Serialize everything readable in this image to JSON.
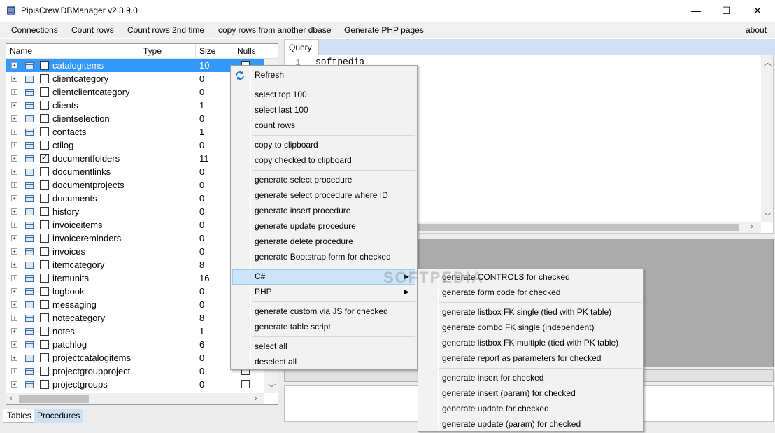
{
  "window": {
    "title": "PipisCrew.DBManager v2.3.9.0",
    "minimize_glyph": "—",
    "maximize_glyph": "☐",
    "close_glyph": "✕"
  },
  "menu": {
    "connections": "Connections",
    "count_rows": "Count rows",
    "count_rows_2nd": "Count rows 2nd time",
    "copy_rows": "copy rows from another dbase",
    "generate_php": "Generate PHP pages",
    "about": "about"
  },
  "tree": {
    "headers": {
      "name": "Name",
      "type": "Type",
      "size": "Size",
      "nulls": "Nulls"
    },
    "rows": [
      {
        "name": "catalogitems",
        "size": "10",
        "checked": false,
        "selected": true
      },
      {
        "name": "clientcategory",
        "size": "0",
        "checked": false
      },
      {
        "name": "clientclientcategory",
        "size": "0",
        "checked": false
      },
      {
        "name": "clients",
        "size": "1",
        "checked": false
      },
      {
        "name": "clientselection",
        "size": "0",
        "checked": false
      },
      {
        "name": "contacts",
        "size": "1",
        "checked": false
      },
      {
        "name": "ctilog",
        "size": "0",
        "checked": false
      },
      {
        "name": "documentfolders",
        "size": "11",
        "checked": true
      },
      {
        "name": "documentlinks",
        "size": "0",
        "checked": false
      },
      {
        "name": "documentprojects",
        "size": "0",
        "checked": false
      },
      {
        "name": "documents",
        "size": "0",
        "checked": false
      },
      {
        "name": "history",
        "size": "0",
        "checked": false
      },
      {
        "name": "invoiceitems",
        "size": "0",
        "checked": false
      },
      {
        "name": "invoicereminders",
        "size": "0",
        "checked": false
      },
      {
        "name": "invoices",
        "size": "0",
        "checked": false
      },
      {
        "name": "itemcategory",
        "size": "8",
        "checked": false
      },
      {
        "name": "itemunits",
        "size": "16",
        "checked": false
      },
      {
        "name": "logbook",
        "size": "0",
        "checked": false
      },
      {
        "name": "messaging",
        "size": "0",
        "checked": false
      },
      {
        "name": "notecategory",
        "size": "8",
        "checked": false
      },
      {
        "name": "notes",
        "size": "1",
        "checked": false
      },
      {
        "name": "patchlog",
        "size": "6",
        "checked": false
      },
      {
        "name": "projectcatalogitems",
        "size": "0",
        "checked": false
      },
      {
        "name": "projectgroupproject",
        "size": "0",
        "checked": false
      },
      {
        "name": "projectgroups",
        "size": "0",
        "checked": false
      }
    ]
  },
  "bottom_tabs": {
    "tables": "Tables",
    "procedures": "Procedures"
  },
  "query": {
    "tab_label": "Query",
    "line_number": "1",
    "text": "softpedia"
  },
  "context_menu": {
    "refresh": "Refresh",
    "select_top": "select top 100",
    "select_last": "select last 100",
    "count_rows": "count rows",
    "copy_clipboard": "copy to clipboard",
    "copy_checked": "copy checked to clipboard",
    "gen_select": "generate select procedure",
    "gen_select_where": "generate select procedure where ID",
    "gen_insert": "generate insert procedure",
    "gen_update": "generate update procedure",
    "gen_delete": "generate delete procedure",
    "gen_bootstrap": "generate Bootstrap form for checked",
    "csharp": "C#",
    "php": "PHP",
    "gen_custom_js": "generate custom via JS for checked",
    "gen_table_script": "generate table script",
    "select_all": "select all",
    "deselect_all": "deselect all"
  },
  "submenu": {
    "controls": "generate CONTROLS for checked",
    "form_code": "generate form code for checked",
    "listbox_fk_single": "generate listbox FK single (tied with PK table)",
    "combo_fk_single": "generate combo FK single (independent)",
    "listbox_fk_multiple": "generate listbox FK multiple (tied with PK table)",
    "report_params": "generate report as parameters for checked",
    "insert_checked": "generate insert for checked",
    "insert_param": "generate insert (param) for checked",
    "update_checked": "generate update for checked",
    "update_param": "generate update (param) for checked"
  },
  "watermark": "SOFTPEDIA",
  "colors": {
    "selection": "#3399ff",
    "tabstrip": "#cfe0f5",
    "menu_bg": "#f2f2f2"
  }
}
